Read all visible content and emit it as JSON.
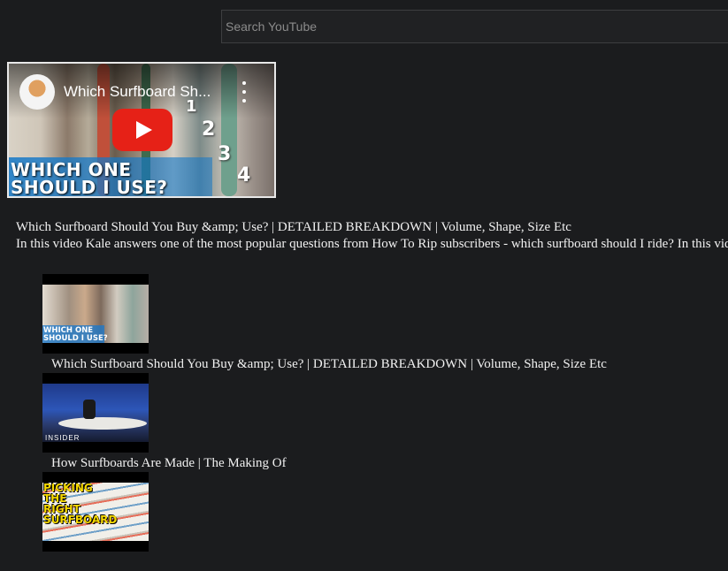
{
  "search": {
    "placeholder": "Search YouTube"
  },
  "player": {
    "title": "Which Surfboard Sh...",
    "overlay_text": "WHICH ONE\nSHOULD I USE?",
    "board_numbers": [
      "1",
      "2",
      "3",
      "4"
    ]
  },
  "video": {
    "title": "Which Surfboard Should You Buy &amp; Use? | DETAILED BREAKDOWN | Volume, Shape, Size Etc",
    "description": "In this video Kale answers one of the most popular questions from How To Rip subscribers - which surfboard should I ride? In this video we break down volume, shape and size."
  },
  "related": [
    {
      "title": "Which Surfboard Should You Buy &amp; Use? | DETAILED BREAKDOWN | Volume, Shape, Size Etc",
      "thumb_text": "WHICH ONE SHOULD I USE?"
    },
    {
      "title": "How Surfboards Are Made | The Making Of",
      "thumb_text": "INSIDER"
    },
    {
      "title": "",
      "thumb_text": "PICKING THE RIGHT SURFBOARD"
    }
  ]
}
